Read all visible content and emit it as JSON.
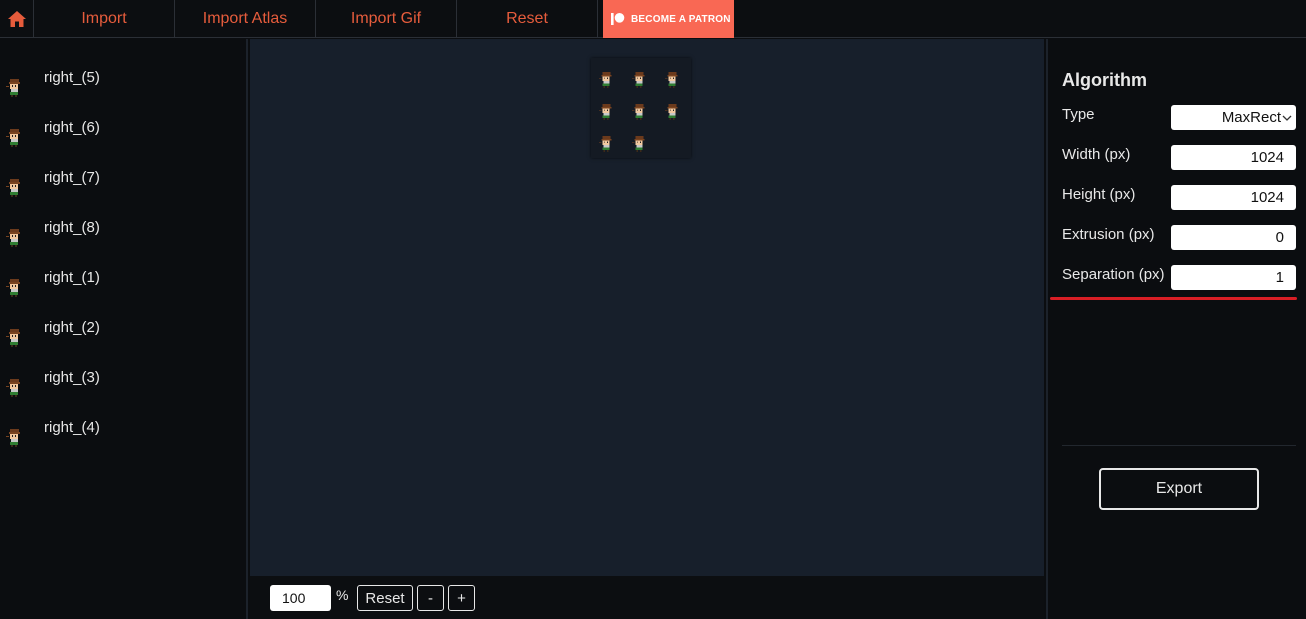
{
  "topbar": {
    "home_icon": "home-icon",
    "buttons": [
      "Import",
      "Import Atlas",
      "Import Gif",
      "Reset"
    ],
    "patron_label": "BECOME A PATRON",
    "patron_icon": "patreon-icon",
    "accent_color": "#e65c3c",
    "patron_color": "#f96854"
  },
  "sidebar": {
    "items": [
      "right_(5)",
      "right_(6)",
      "right_(7)",
      "right_(8)",
      "right_(1)",
      "right_(2)",
      "right_(3)",
      "right_(4)"
    ],
    "thumb_icon": "character-sprite-icon"
  },
  "zoom": {
    "value": "100",
    "unit": "%",
    "reset_label": "Reset",
    "minus_label": "-",
    "plus_label": "+"
  },
  "algorithm": {
    "title": "Algorithm",
    "type_label": "Type",
    "type_value": "MaxRect",
    "width_label": "Width (px)",
    "width_value": "1024",
    "height_label": "Height (px)",
    "height_value": "1024",
    "extrusion_label": "Extrusion (px)",
    "extrusion_value": "0",
    "separation_label": "Separation (px)",
    "separation_value": "1",
    "highlight_color": "#d91e25"
  },
  "export_label": "Export"
}
